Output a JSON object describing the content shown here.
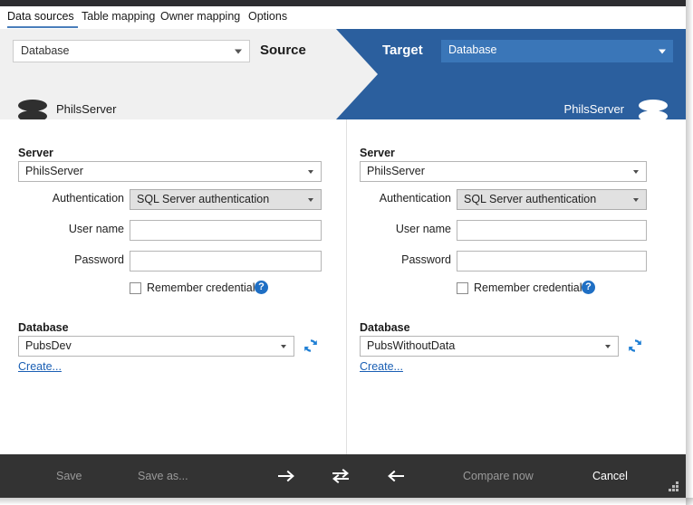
{
  "window": {
    "tabs": [
      {
        "label": "Data sources",
        "active": true
      },
      {
        "label": "Table mapping",
        "active": false
      },
      {
        "label": "Owner mapping",
        "active": false
      },
      {
        "label": "Options",
        "active": false
      }
    ]
  },
  "colors": {
    "accent_blue": "#2b5f9e",
    "target_select_blue": "#3a76b8",
    "tab_underline": "#4a7ebb",
    "link_blue": "#1a5fb4",
    "bottom_bar": "#333333",
    "panel_gray": "#f0f0f0"
  },
  "header": {
    "source": {
      "title": "Source",
      "type_select_value": "Database",
      "server_name": "PhilsServer",
      "database_name": "PubsDev",
      "icon": "database-icon"
    },
    "target": {
      "title": "Target",
      "type_select_value": "Database",
      "server_name": "PhilsServer",
      "database_name": "PubsWithoutData",
      "icon": "database-icon"
    }
  },
  "source_panel": {
    "server_group_title": "Server",
    "server_value": "PhilsServer",
    "authentication_label": "Authentication",
    "authentication_value": "SQL Server authentication",
    "user_name_label": "User name",
    "user_name_value": "",
    "password_label": "Password",
    "password_value": "",
    "remember_label": "Remember credentials",
    "remember_checked": false,
    "help_icon": "question-mark-icon",
    "database_group_title": "Database",
    "database_value": "PubsDev",
    "refresh_icon": "refresh-icon",
    "create_link": "Create..."
  },
  "target_panel": {
    "server_group_title": "Server",
    "server_value": "PhilsServer",
    "authentication_label": "Authentication",
    "authentication_value": "SQL Server authentication",
    "user_name_label": "User name",
    "user_name_value": "",
    "password_label": "Password",
    "password_value": "",
    "remember_label": "Remember credentials",
    "remember_checked": false,
    "help_icon": "question-mark-icon",
    "database_group_title": "Database",
    "database_value": "PubsWithoutData",
    "refresh_icon": "refresh-icon",
    "create_link": "Create..."
  },
  "bottom_bar": {
    "save_label": "Save",
    "save_as_label": "Save as...",
    "copy_right_icon": "arrow-right-icon",
    "swap_icon": "swap-arrows-icon",
    "copy_left_icon": "arrow-left-icon",
    "compare_label": "Compare now",
    "cancel_label": "Cancel",
    "resize_grip": "resize-grip-icon"
  }
}
